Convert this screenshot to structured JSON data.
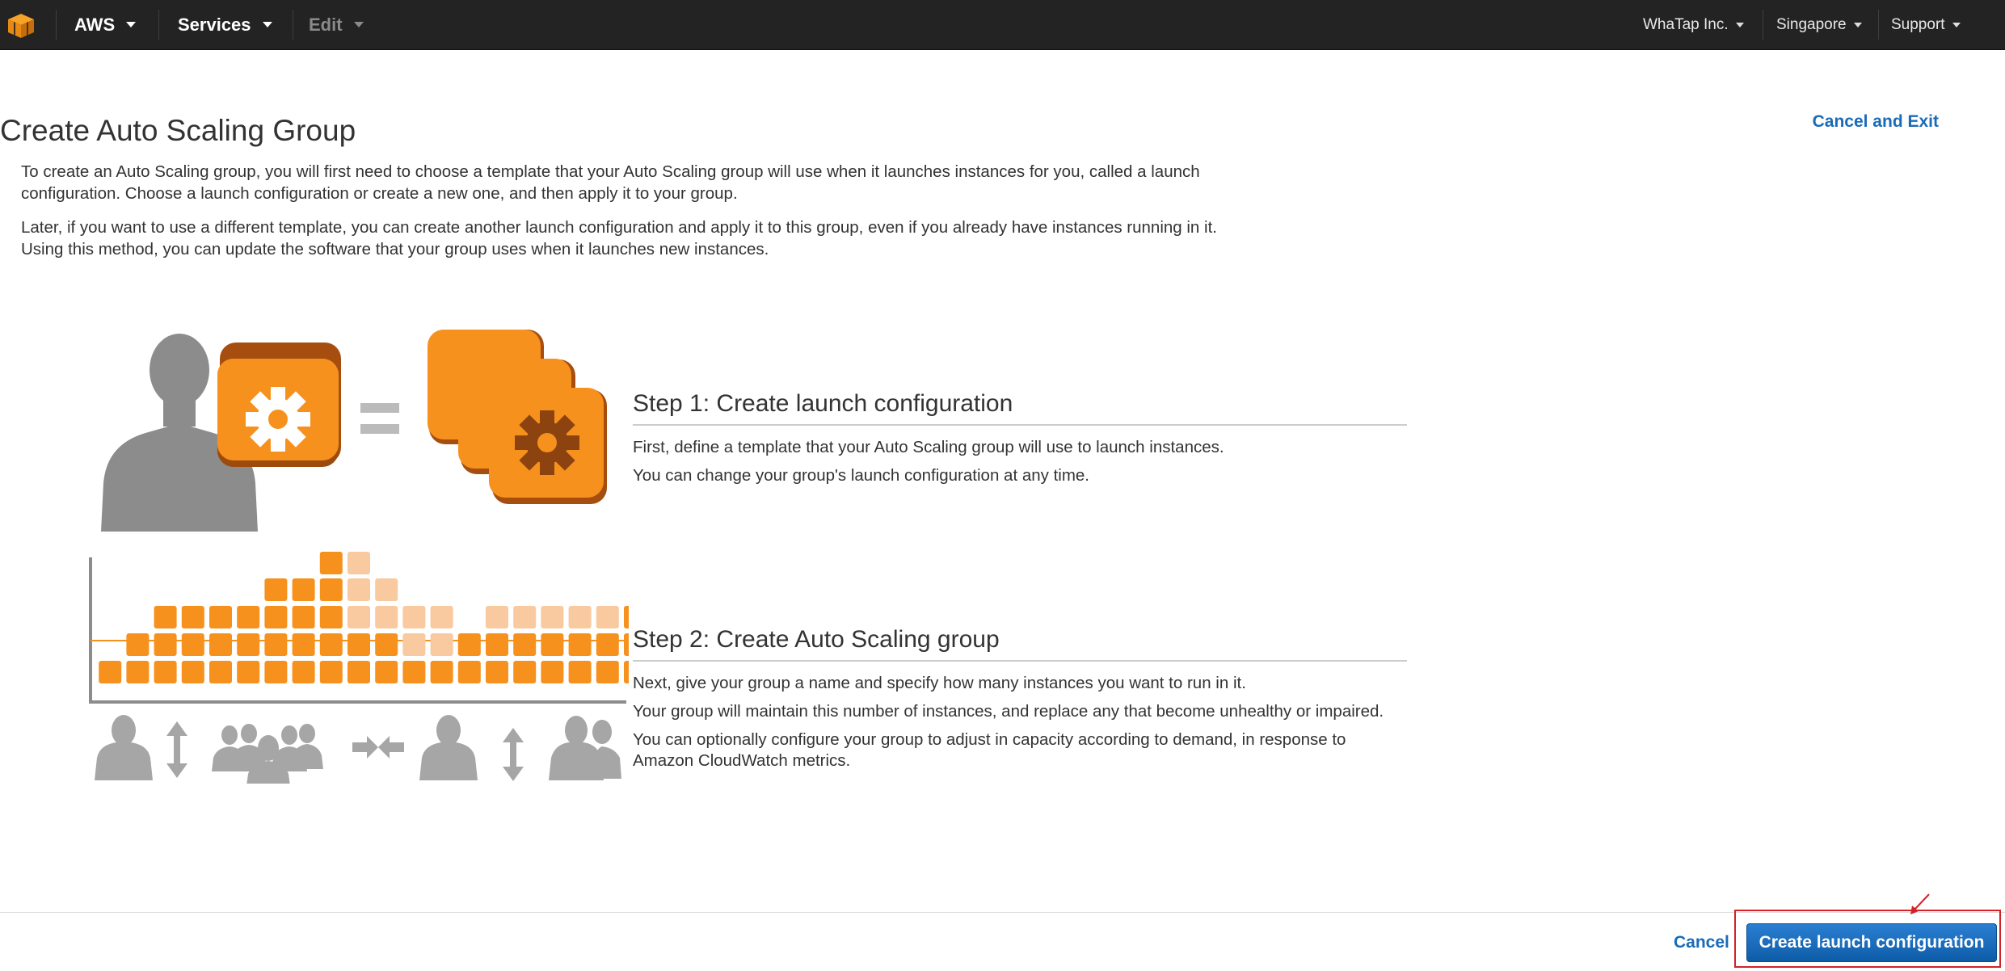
{
  "nav": {
    "brand": "AWS",
    "services": "Services",
    "edit": "Edit",
    "account": "WhaTap Inc.",
    "region": "Singapore",
    "support": "Support"
  },
  "header": {
    "title": "Create Auto Scaling Group",
    "cancel_exit": "Cancel and Exit"
  },
  "intro": {
    "p1_line1": "To create an Auto Scaling group, you will first need to choose a template that your Auto Scaling group will use when it launches instances for you, called a launch",
    "p1_line2": "configuration. Choose a launch configuration or create a new one, and then apply it to your group.",
    "p2_line1": "Later, if you want to use a different template, you can create another launch configuration and apply it to this group, even if you already have instances running in it.",
    "p2_line2": "Using this method, you can update the software that your group uses when it launches new instances."
  },
  "steps": [
    {
      "heading": "Step 1: Create launch configuration",
      "lines": [
        "First, define a template that your Auto Scaling group will use to launch instances.",
        "You can change your group's launch configuration at any time."
      ]
    },
    {
      "heading": "Step 2: Create Auto Scaling group",
      "lines": [
        "Next, give your group a name and specify how many instances you want to run in it.",
        "Your group will maintain this number of instances, and replace any that become unhealthy or impaired.",
        "You can optionally configure your group to adjust in capacity according to demand, in response to",
        "Amazon CloudWatch metrics."
      ]
    }
  ],
  "footer": {
    "cancel": "Cancel",
    "primary": "Create launch configuration"
  },
  "colors": {
    "nav_bg": "#232323",
    "link": "#1a6bb8",
    "primary_button": "#1266bd",
    "orange": "#f7911e",
    "light_orange": "#f9c9a0",
    "gray_figure": "#8c8c8c",
    "highlight": "#d42128"
  },
  "icons": {
    "logo": "aws-cube-icon",
    "illustration1": "user-gear-equals-launch-config-illustration",
    "illustration2": "instances-scaling-illustration"
  }
}
